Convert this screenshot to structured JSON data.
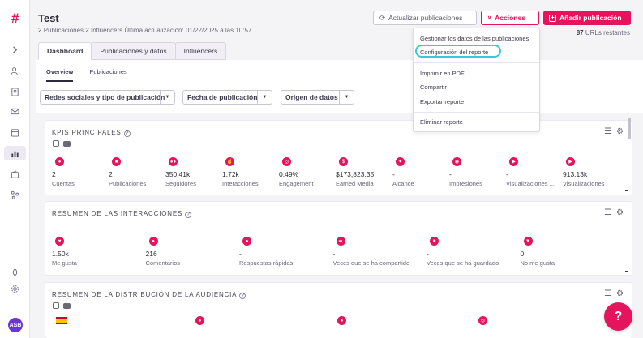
{
  "header": {
    "title": "Test",
    "pubs_count": "2",
    "pubs_label": "Publicaciones",
    "influencers_count": "2",
    "influencers_label": "Influencers",
    "last_update": "Última actualización: 01/22/2025 a las 10:57",
    "update_button": "Actualizar publicaciones",
    "actions_button": "Acciones",
    "add_button": "Añadir publicación",
    "urls_count": "87",
    "urls_label": "URLs restantes"
  },
  "tabs": [
    "Dashboard",
    "Publicaciones y datos",
    "Influencers"
  ],
  "subtabs": [
    "Overview",
    "Publicaciones"
  ],
  "filters": [
    "Redes sociales y tipo de publicación",
    "Fecha de publicación",
    "Origen de datos"
  ],
  "dropdown": {
    "items": [
      "Gestionar los datos de las publicaciones",
      "Configuración del reporte",
      "Imprimir en PDF",
      "Compartir",
      "Exportar reporte",
      "Eliminar reporte"
    ]
  },
  "kpis": {
    "title": "KPIS PRINCIPALES",
    "metrics": [
      {
        "value": "2",
        "label": "Cuentas"
      },
      {
        "value": "2",
        "label": "Publicaciones"
      },
      {
        "value": "350.41k",
        "label": "Seguidores"
      },
      {
        "value": "1.72k",
        "label": "Interacciones"
      },
      {
        "value": "0.49%",
        "label": "Engagement"
      },
      {
        "value": "$173,823.35",
        "label": "Earned Media"
      },
      {
        "value": "-",
        "label": "Alcance"
      },
      {
        "value": "-",
        "label": "Impresiones"
      },
      {
        "value": "-",
        "label": "Visualizaciones ..."
      },
      {
        "value": "913.13k",
        "label": "Visualizaciones"
      }
    ]
  },
  "interactions": {
    "title": "RESUMEN DE LAS INTERACCIONES",
    "metrics": [
      {
        "value": "1.50k",
        "label": "Me gusta"
      },
      {
        "value": "216",
        "label": "Comentarios"
      },
      {
        "value": "-",
        "label": "Respuestas rápidas"
      },
      {
        "value": "-",
        "label": "Veces que se ha compartido"
      },
      {
        "value": "-",
        "label": "Veces que se ha guardado"
      },
      {
        "value": "0",
        "label": "No me gusta"
      }
    ]
  },
  "audience": {
    "title": "RESUMEN DE LA DISTRIBUCIÓN DE LA AUDIENCIA"
  },
  "user": {
    "initials": "ASB"
  },
  "colors": {
    "brand": "#e5145c",
    "highlight": "#36c9d8",
    "avatar": "#6b36d6"
  }
}
